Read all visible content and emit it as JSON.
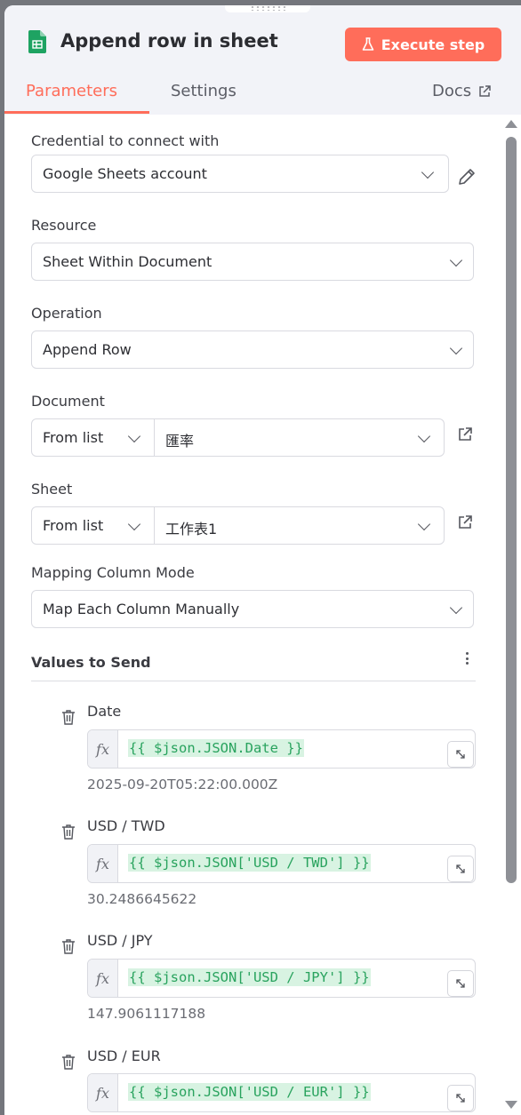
{
  "header": {
    "title": "Append row in sheet",
    "execute_label": "Execute step",
    "tabs": [
      {
        "label": "Parameters"
      },
      {
        "label": "Settings"
      }
    ],
    "docs_label": "Docs"
  },
  "form": {
    "credential": {
      "label": "Credential to connect with",
      "value": "Google Sheets account"
    },
    "resource": {
      "label": "Resource",
      "value": "Sheet Within Document"
    },
    "operation": {
      "label": "Operation",
      "value": "Append Row"
    },
    "document": {
      "label": "Document",
      "mode": "From list",
      "value": "匯率"
    },
    "sheet": {
      "label": "Sheet",
      "mode": "From list",
      "value": "工作表1"
    },
    "mapping": {
      "label": "Mapping Column Mode",
      "value": "Map Each Column Manually"
    },
    "values_label": "Values to Send"
  },
  "values": [
    {
      "name": "Date",
      "expression": "{{ $json.JSON.Date }}",
      "result": "2025-09-20T05:22:00.000Z"
    },
    {
      "name": "USD / TWD",
      "expression": "{{ $json.JSON['USD / TWD'] }}",
      "result": "30.2486645622"
    },
    {
      "name": "USD / JPY",
      "expression": "{{ $json.JSON['USD / JPY'] }}",
      "result": "147.9061117188"
    },
    {
      "name": "USD / EUR",
      "expression": "{{ $json.JSON['USD / EUR'] }}",
      "result": ""
    }
  ],
  "colors": {
    "accent": "#ff6d5a",
    "expression": "#29a35e"
  }
}
